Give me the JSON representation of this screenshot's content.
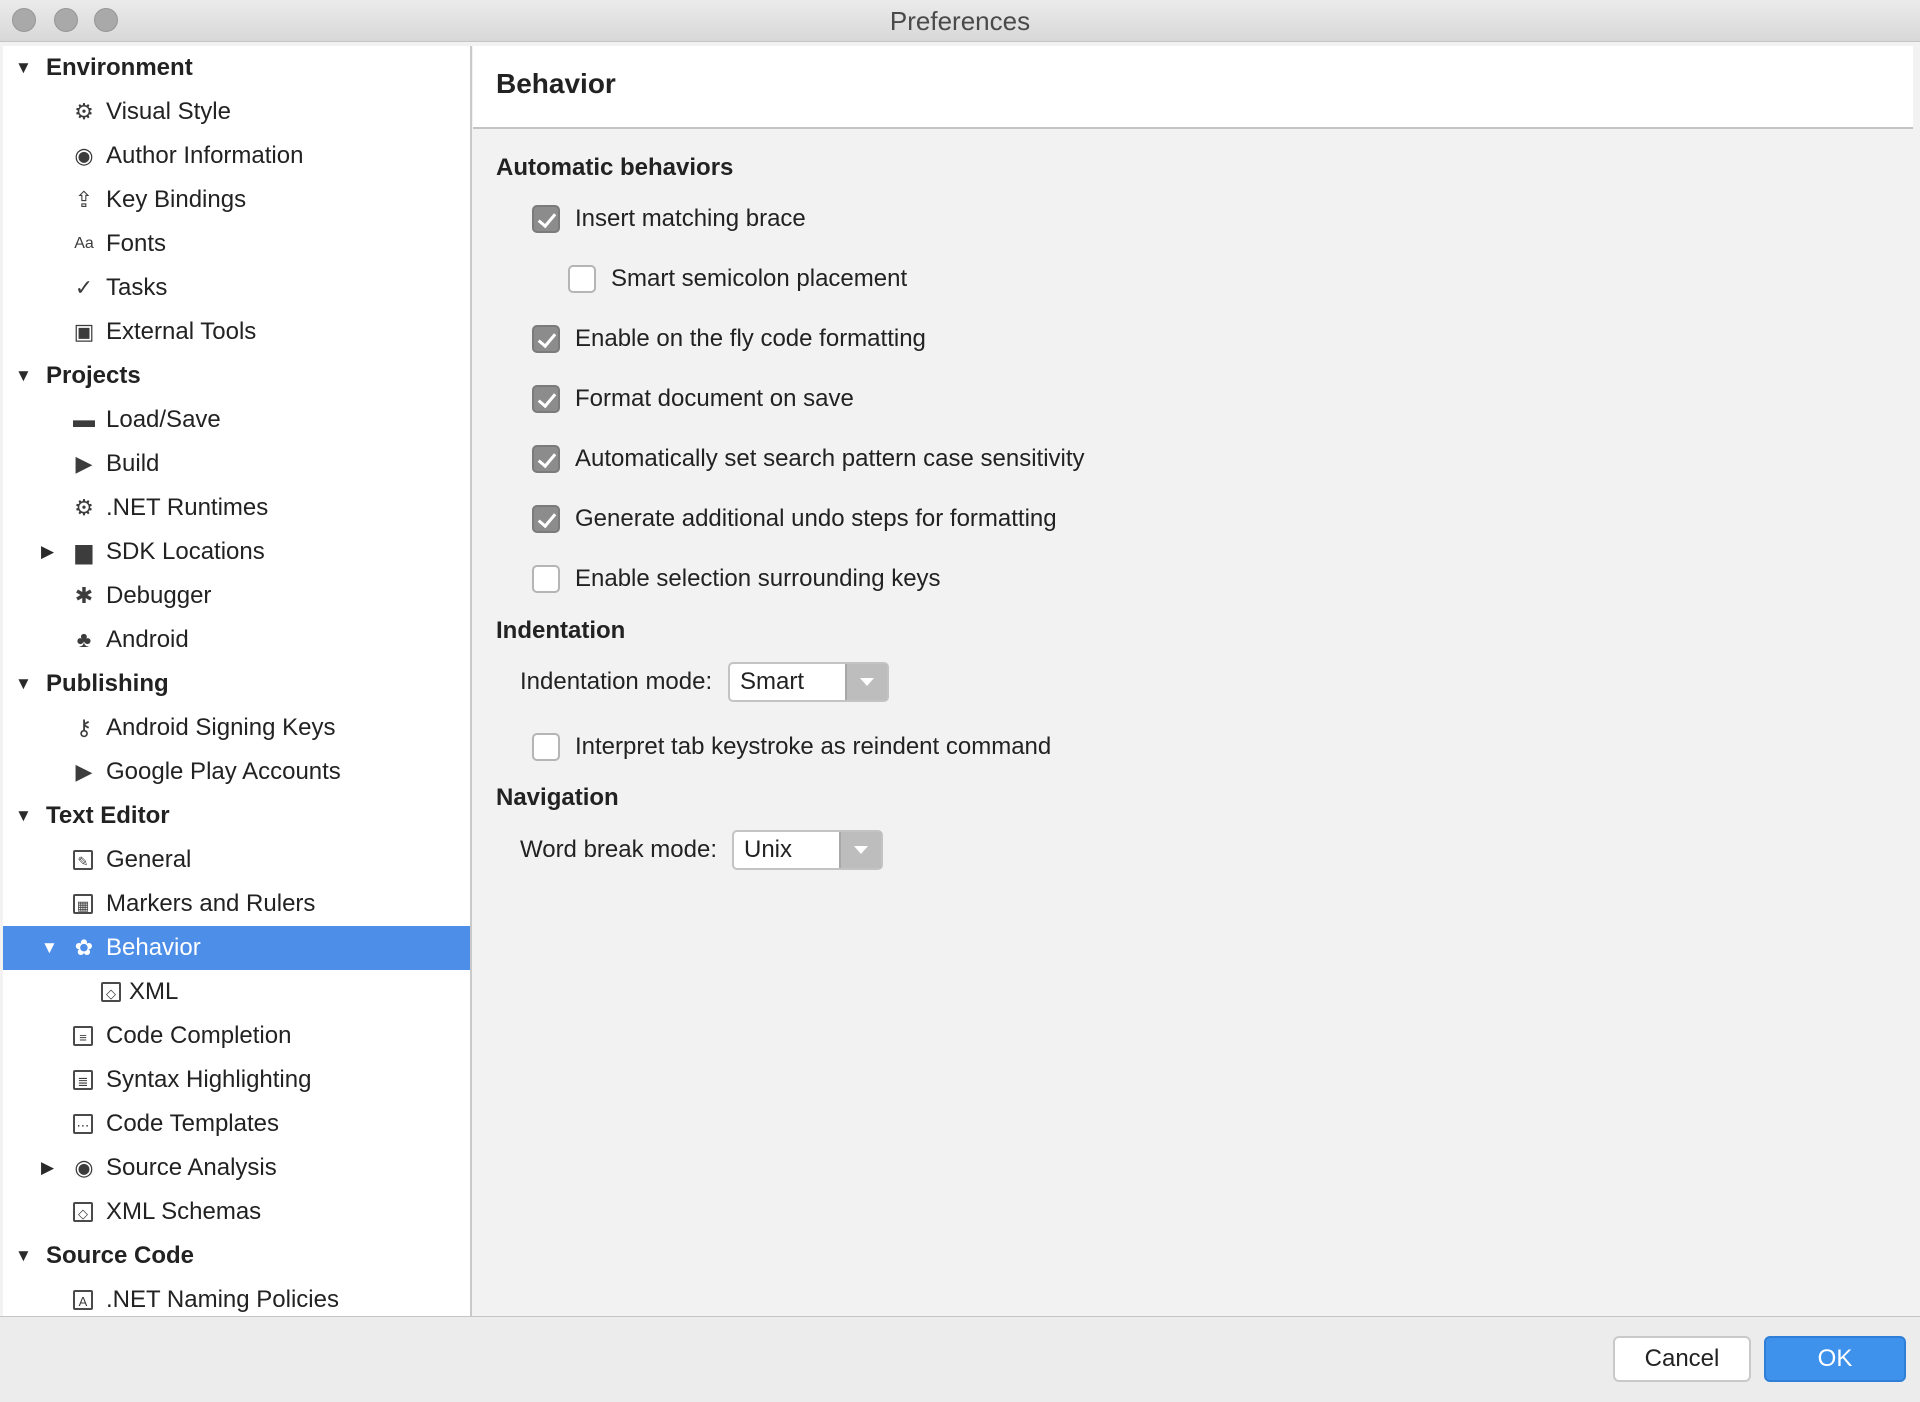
{
  "window": {
    "title": "Preferences"
  },
  "sidebar": {
    "items": [
      {
        "label": "Environment",
        "level": 0,
        "expanded": true,
        "group": true
      },
      {
        "label": "Visual Style",
        "level": 1,
        "icon": "gear-icon"
      },
      {
        "label": "Author Information",
        "level": 1,
        "icon": "user-circle-icon"
      },
      {
        "label": "Key Bindings",
        "level": 1,
        "icon": "keyboard-icon"
      },
      {
        "label": "Fonts",
        "level": 1,
        "icon": "font-icon"
      },
      {
        "label": "Tasks",
        "level": 1,
        "icon": "checkmark-icon"
      },
      {
        "label": "External Tools",
        "level": 1,
        "icon": "terminal-icon"
      },
      {
        "label": "Projects",
        "level": 0,
        "expanded": true,
        "group": true
      },
      {
        "label": "Load/Save",
        "level": 1,
        "icon": "drive-icon"
      },
      {
        "label": "Build",
        "level": 1,
        "icon": "build-play-icon"
      },
      {
        "label": ".NET Runtimes",
        "level": 1,
        "icon": "gear-icon"
      },
      {
        "label": "SDK Locations",
        "level": 1,
        "icon": "folder-icon",
        "collapsed": true
      },
      {
        "label": "Debugger",
        "level": 1,
        "icon": "bug-icon"
      },
      {
        "label": "Android",
        "level": 1,
        "icon": "android-icon"
      },
      {
        "label": "Publishing",
        "level": 0,
        "expanded": true,
        "group": true
      },
      {
        "label": "Android Signing Keys",
        "level": 1,
        "icon": "key-icon"
      },
      {
        "label": "Google Play Accounts",
        "level": 1,
        "icon": "google-play-icon"
      },
      {
        "label": "Text Editor",
        "level": 0,
        "expanded": true,
        "group": true
      },
      {
        "label": "General",
        "level": 1,
        "icon": "pencil-box-icon"
      },
      {
        "label": "Markers and Rulers",
        "level": 1,
        "icon": "grid-box-icon"
      },
      {
        "label": "Behavior",
        "level": 1,
        "icon": "brain-icon",
        "expanded": true,
        "selected": true
      },
      {
        "label": "XML",
        "level": 2,
        "icon": "xml-box-icon"
      },
      {
        "label": "Code Completion",
        "level": 1,
        "icon": "list-box-icon"
      },
      {
        "label": "Syntax Highlighting",
        "level": 1,
        "icon": "lines-box-icon"
      },
      {
        "label": "Code Templates",
        "level": 1,
        "icon": "dots-box-icon"
      },
      {
        "label": "Source Analysis",
        "level": 1,
        "icon": "radio-circle-icon",
        "collapsed": true
      },
      {
        "label": "XML Schemas",
        "level": 1,
        "icon": "xml-box-icon"
      },
      {
        "label": "Source Code",
        "level": 0,
        "expanded": true,
        "group": true
      },
      {
        "label": ".NET Naming Policies",
        "level": 1,
        "icon": "naming-box-icon"
      }
    ]
  },
  "main": {
    "title": "Behavior",
    "sections": {
      "automatic": "Automatic behaviors",
      "indentation": "Indentation",
      "navigation": "Navigation"
    },
    "options": {
      "insert_brace": {
        "label": "Insert matching brace",
        "checked": true
      },
      "smart_semicolon": {
        "label": "Smart semicolon placement",
        "checked": false
      },
      "fly_formatting": {
        "label": "Enable on the fly code formatting",
        "checked": true
      },
      "format_on_save": {
        "label": "Format document on save",
        "checked": true
      },
      "search_case": {
        "label": "Automatically set search pattern case sensitivity",
        "checked": true
      },
      "undo_steps": {
        "label": "Generate additional undo steps for formatting",
        "checked": true
      },
      "selection_keys": {
        "label": "Enable selection surrounding keys",
        "checked": false
      },
      "tab_reindent": {
        "label": "Interpret tab keystroke as reindent command",
        "checked": false
      }
    },
    "indentation_mode": {
      "label": "Indentation mode:",
      "value": "Smart"
    },
    "word_break_mode": {
      "label": "Word break mode:",
      "value": "Unix"
    }
  },
  "footer": {
    "cancel_label": "Cancel",
    "ok_label": "OK"
  },
  "colors": {
    "selection": "#4d8fe8",
    "ok_button": "#3f92ec",
    "checkbox_checked": "#8c8c8c"
  }
}
